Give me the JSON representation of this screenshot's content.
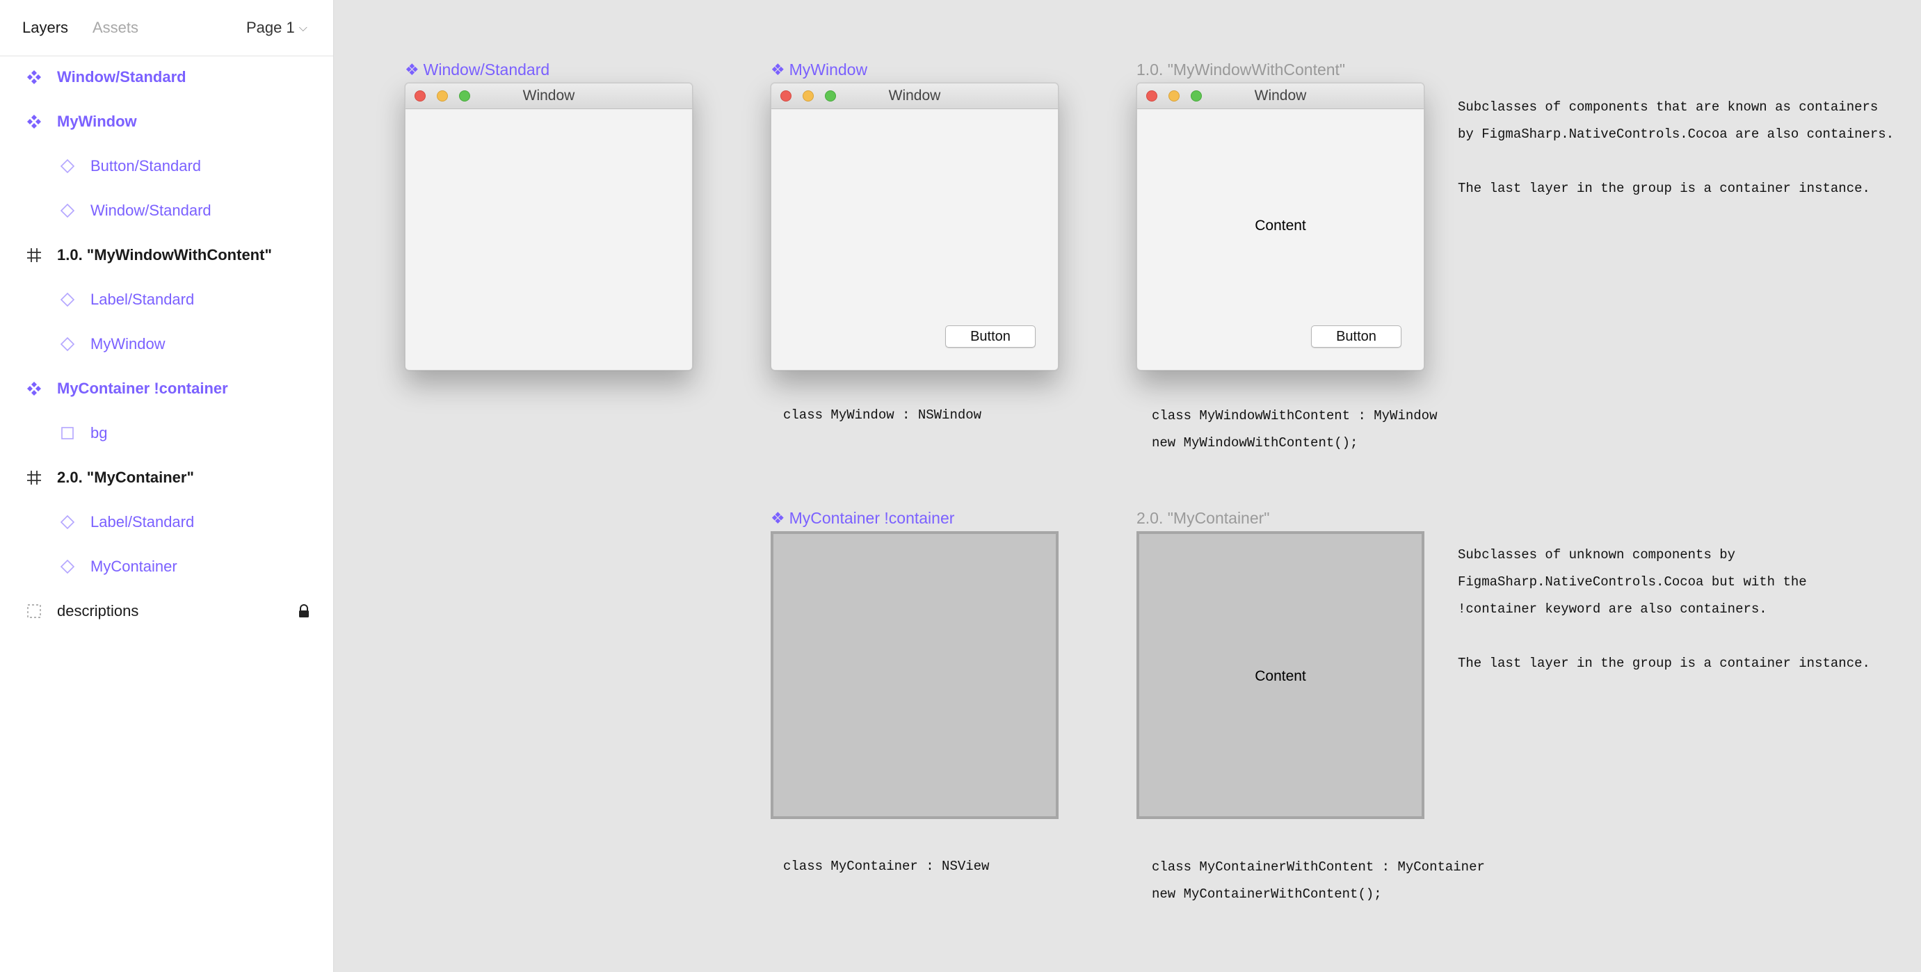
{
  "sidebar": {
    "tabs": {
      "layers": "Layers",
      "assets": "Assets"
    },
    "page_selector": "Page 1",
    "layers": [
      {
        "label": "Window/Standard",
        "kind": "component"
      },
      {
        "label": "MyWindow",
        "kind": "component"
      },
      {
        "label": "Button/Standard",
        "kind": "instance"
      },
      {
        "label": "Window/Standard",
        "kind": "instance"
      },
      {
        "label": "1.0. \"MyWindowWithContent\"",
        "kind": "frame"
      },
      {
        "label": "Label/Standard",
        "kind": "instance"
      },
      {
        "label": "MyWindow",
        "kind": "instance"
      },
      {
        "label": "MyContainer !container",
        "kind": "component"
      },
      {
        "label": "bg",
        "kind": "rectangle"
      },
      {
        "label": "2.0. \"MyContainer\"",
        "kind": "frame"
      },
      {
        "label": "Label/Standard",
        "kind": "instance"
      },
      {
        "label": "MyContainer",
        "kind": "instance"
      },
      {
        "label": "descriptions",
        "kind": "group",
        "locked": true
      }
    ]
  },
  "canvas": {
    "labels": {
      "window_standard": "Window/Standard",
      "mywindow": "MyWindow",
      "mywindow_with_content": "1.0. \"MyWindowWithContent\"",
      "mycontainer": "MyContainer !container",
      "mycontainer_frame": "2.0. \"MyContainer\""
    },
    "window_title": "Window",
    "button_label": "Button",
    "content_label": "Content",
    "code": {
      "mywindow": "class MyWindow : NSWindow",
      "mywindow_with_content_1": "class MyWindowWithContent : MyWindow",
      "mywindow_with_content_2": "new MyWindowWithContent();",
      "mycontainer": "class MyContainer : NSView",
      "mycontainer_with_content_1": "class MyContainerWithContent : MyContainer",
      "mycontainer_with_content_2": "new MyContainerWithContent();"
    },
    "descriptions": {
      "top_1": "Subclasses of components that are known as containers",
      "top_2": "by FigmaSharp.NativeControls.Cocoa are also containers.",
      "top_3": "The last layer in the group is a container instance.",
      "bottom_1": "Subclasses of unknown components by",
      "bottom_2": "FigmaSharp.NativeControls.Cocoa but with the",
      "bottom_3": "!container keyword are also containers.",
      "bottom_4": "The last layer in the group is a container instance."
    }
  },
  "colors": {
    "component_purple": "#7b61ff",
    "canvas_bg": "#e5e5e5",
    "container_fill": "#c5c5c5"
  },
  "icons": {
    "component": "component-icon",
    "instance": "instance-icon",
    "frame": "frame-hash-icon",
    "rectangle": "rectangle-icon",
    "group": "group-dashed-icon",
    "lock": "lock-icon",
    "chevron": "chevron-down-icon"
  }
}
